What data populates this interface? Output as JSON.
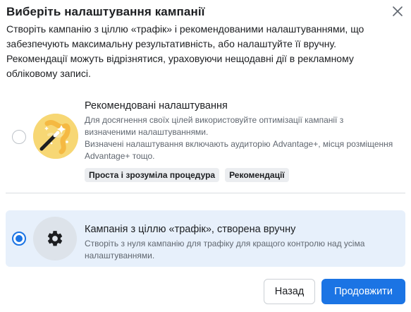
{
  "dialog": {
    "title": "Виберіть налаштування кампанії",
    "description": "Створіть кампанію з ціллю «трафік» і рекомендованими налаштуваннями, що забезпечують максимальну результативність, або налаштуйте її вручну. Рекомендації можуть відрізнятися, ураховуючи нещодавні дії в рекламному обліковому записі.",
    "close_icon": "close-icon"
  },
  "options": [
    {
      "title": "Рекомендовані налаштування",
      "subtitle_1": "Для досягнення своїх цілей використовуйте оптимізації кампанії з визначеними налаштуваннями.",
      "subtitle_2": "Визначені налаштування включають аудиторію Advantage+, місця розміщення Advantage+ тощо.",
      "tags": [
        "Проста і зрозуміла процедура",
        "Рекомендації"
      ],
      "selected": false,
      "icon": "magic-wand-icon"
    },
    {
      "title": "Кампанія з ціллю «трафік», створена вручну",
      "subtitle": "Створіть з нуля кампанію для трафіку для кращого контролю над усіма налаштуваннями.",
      "selected": true,
      "icon": "gear-icon"
    }
  ],
  "buttons": {
    "back": "Назад",
    "continue": "Продовжити"
  },
  "colors": {
    "accent": "#1b74e4",
    "selected_bg": "#e7f0fb",
    "illustration_bg": "#f7d774"
  }
}
